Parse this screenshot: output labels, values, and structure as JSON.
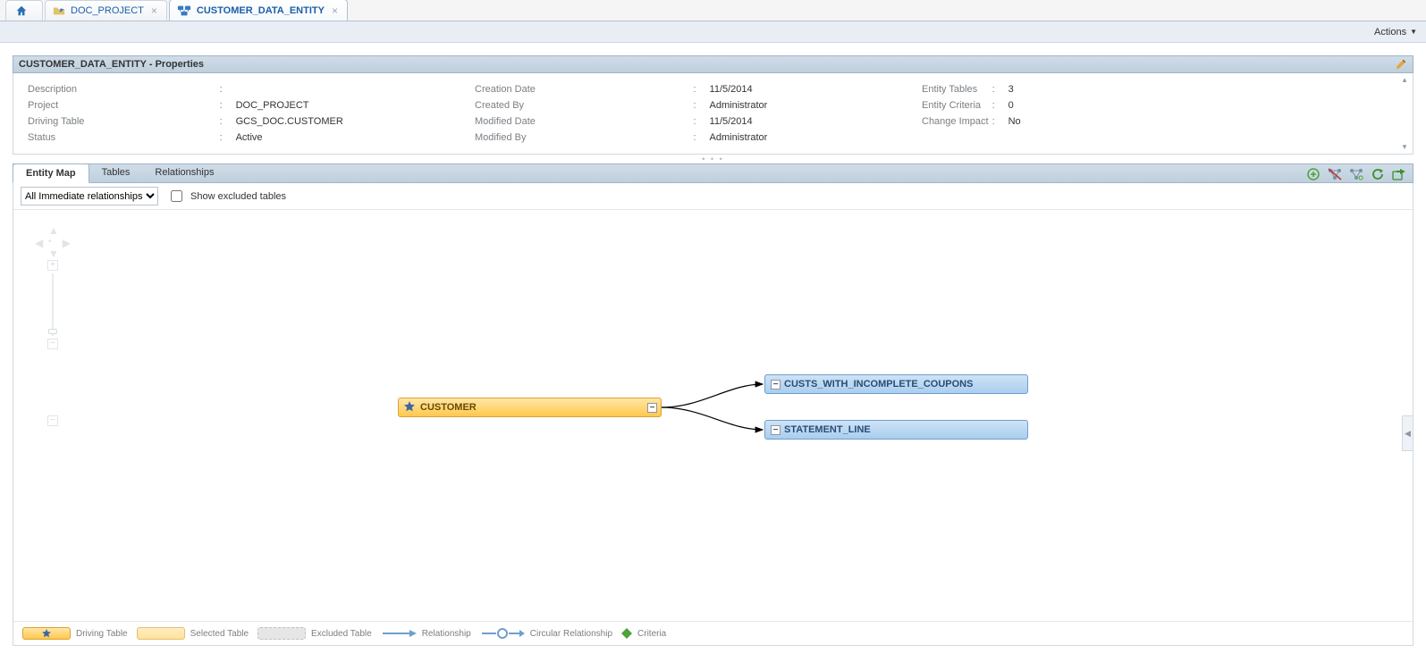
{
  "tabs": {
    "doc_project_label": "DOC_PROJECT",
    "customer_entity_label": "CUSTOMER_DATA_ENTITY"
  },
  "actions_menu_label": "Actions",
  "properties": {
    "header": "CUSTOMER_DATA_ENTITY - Properties",
    "col1": {
      "description_label": "Description",
      "description_value": "",
      "project_label": "Project",
      "project_value": "DOC_PROJECT",
      "driving_table_label": "Driving Table",
      "driving_table_value": "GCS_DOC.CUSTOMER",
      "status_label": "Status",
      "status_value": "Active"
    },
    "col2": {
      "creation_date_label": "Creation Date",
      "creation_date_value": "11/5/2014",
      "created_by_label": "Created By",
      "created_by_value": "Administrator",
      "modified_date_label": "Modified Date",
      "modified_date_value": "11/5/2014",
      "modified_by_label": "Modified By",
      "modified_by_value": "Administrator"
    },
    "col3": {
      "entity_tables_label": "Entity Tables",
      "entity_tables_value": "3",
      "entity_criteria_label": "Entity Criteria",
      "entity_criteria_value": "0",
      "change_impact_label": "Change Impact",
      "change_impact_value": "No"
    }
  },
  "lower_tabs": {
    "entity_map": "Entity Map",
    "tables": "Tables",
    "relationships": "Relationships"
  },
  "filter": {
    "select_value": "All Immediate relationships",
    "checkbox_label": "Show excluded tables"
  },
  "nodes": {
    "customer": "CUSTOMER",
    "coupons": "CUSTS_WITH_INCOMPLETE_COUPONS",
    "statement": "STATEMENT_LINE",
    "collapse_glyph": "−"
  },
  "legend": {
    "driving": "Driving Table",
    "selected": "Selected Table",
    "excluded": "Excluded Table",
    "relationship": "Relationship",
    "circular": "Circular Relationship",
    "criteria": "Criteria"
  }
}
